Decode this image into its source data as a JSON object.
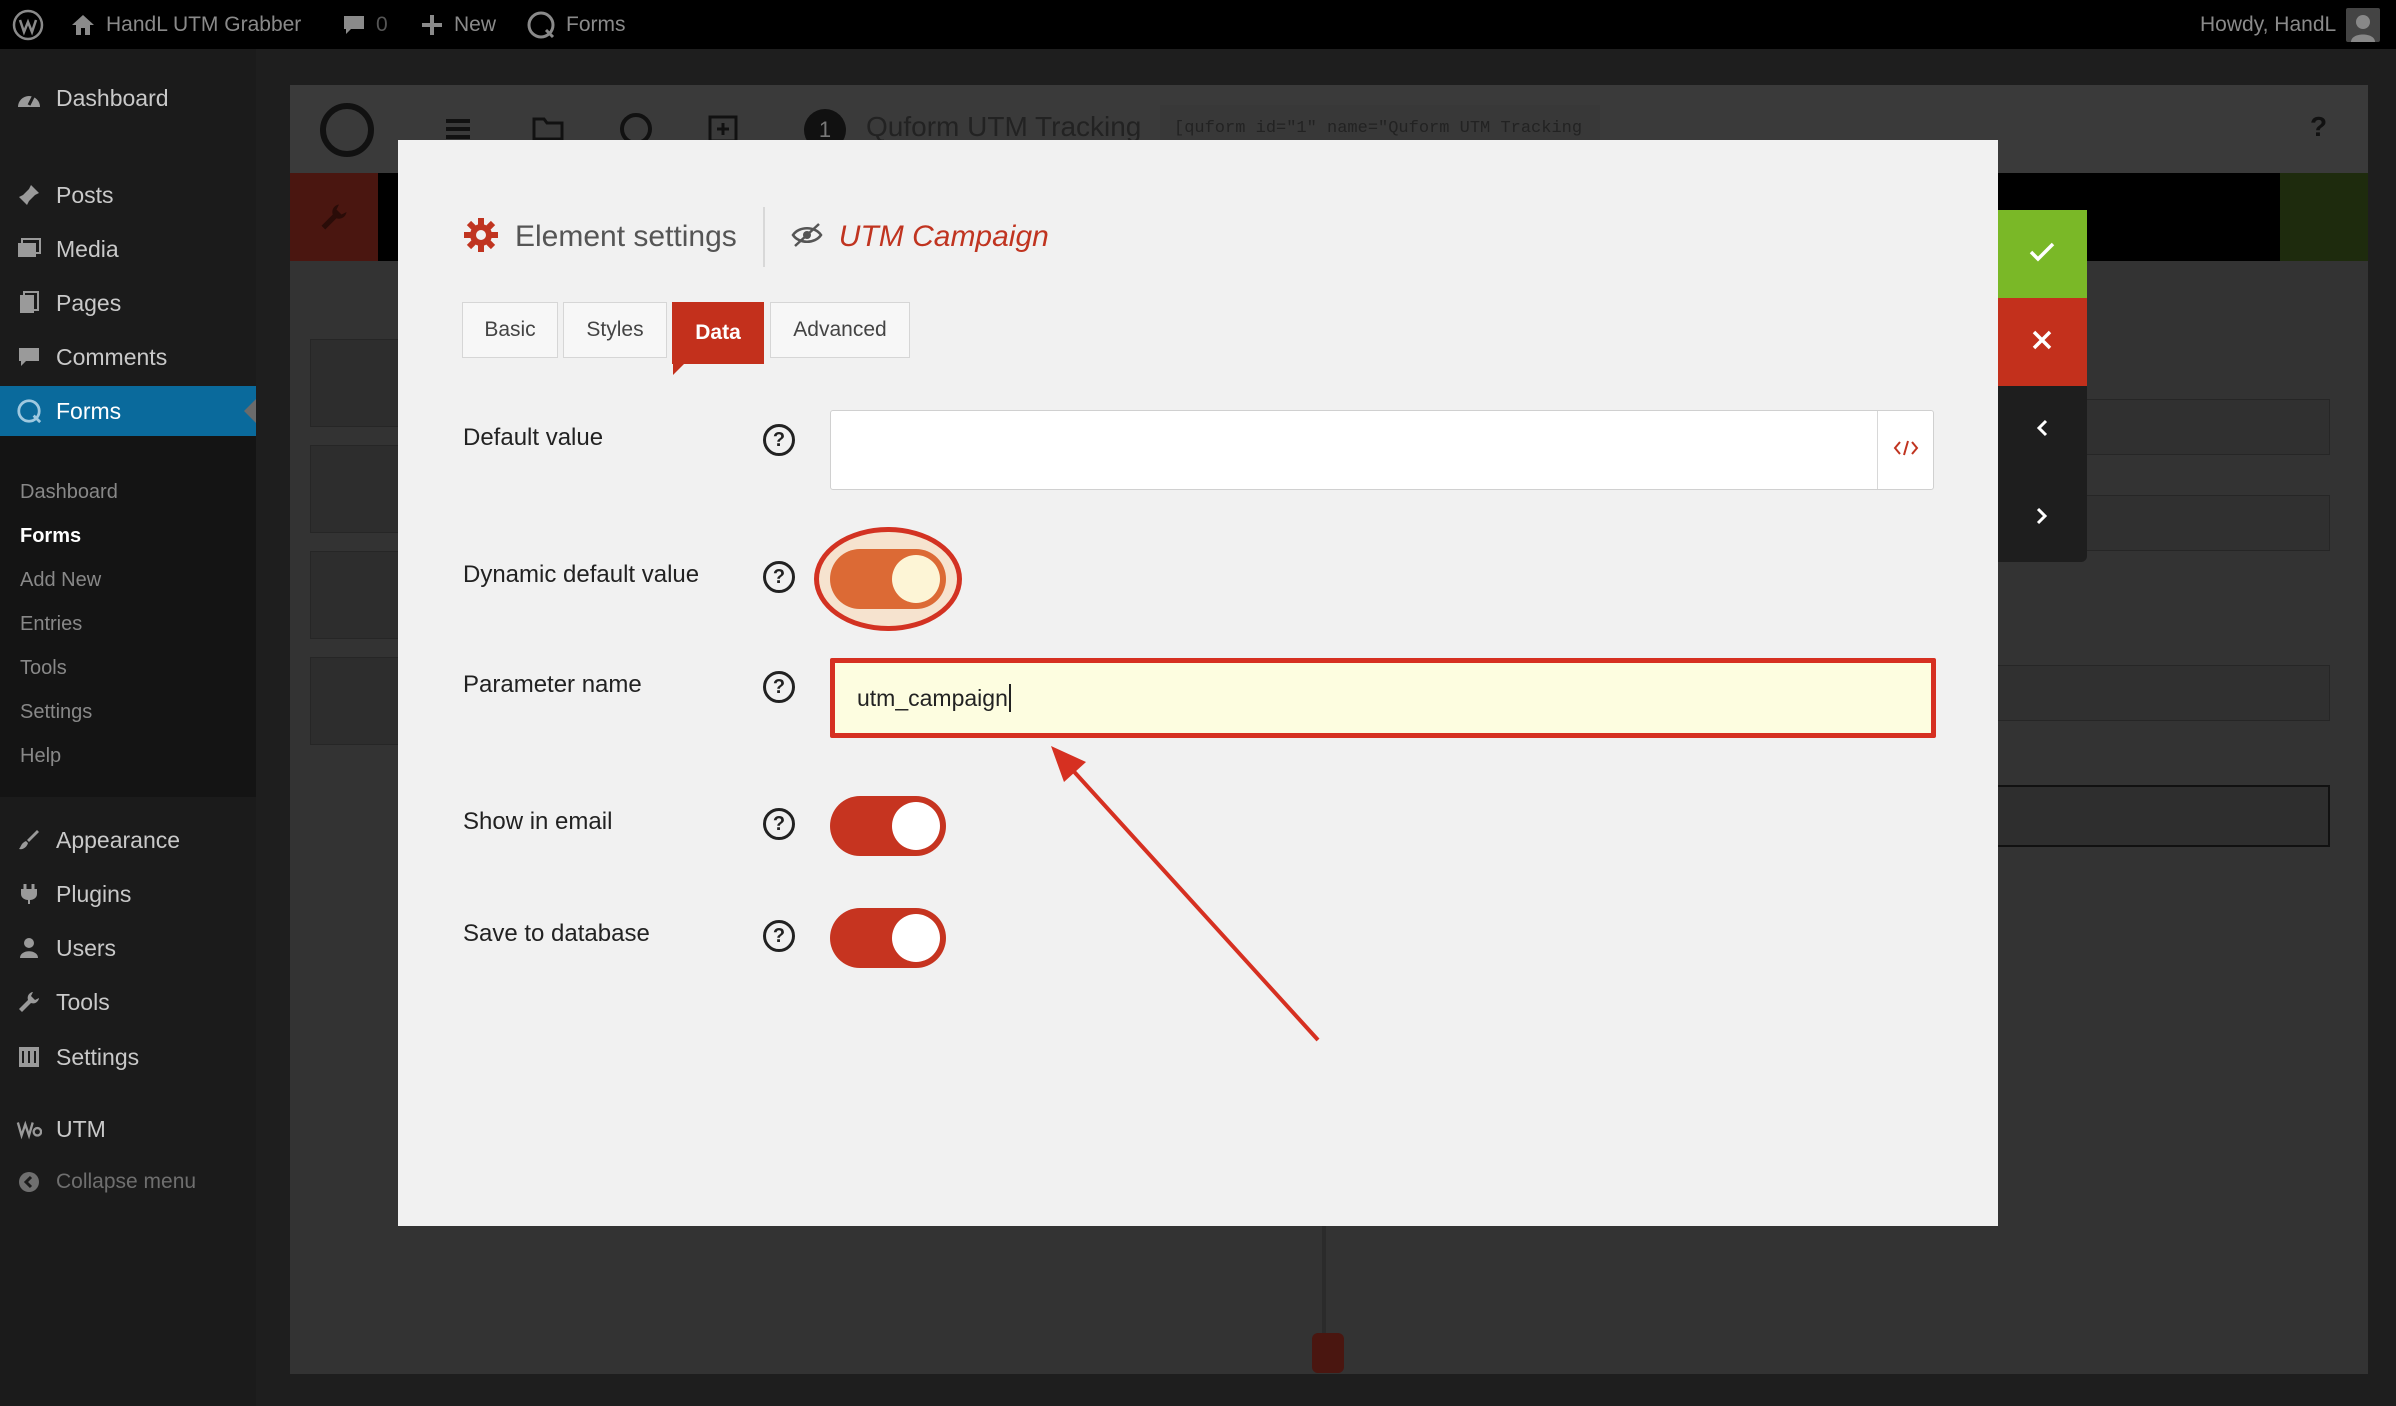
{
  "adminbar": {
    "site_name": "HandL UTM Grabber",
    "comments_count": "0",
    "new_label": "New",
    "forms_label": "Forms",
    "greeting": "Howdy, HandL"
  },
  "sidebar": {
    "items": [
      {
        "label": "Dashboard",
        "icon": "dashboard-icon"
      },
      {
        "label": "Posts",
        "icon": "pin-icon"
      },
      {
        "label": "Media",
        "icon": "media-icon"
      },
      {
        "label": "Pages",
        "icon": "pages-icon"
      },
      {
        "label": "Comments",
        "icon": "comment-icon"
      },
      {
        "label": "Forms",
        "icon": "quform-icon"
      },
      {
        "label": "Appearance",
        "icon": "brush-icon"
      },
      {
        "label": "Plugins",
        "icon": "plug-icon"
      },
      {
        "label": "Users",
        "icon": "user-icon"
      },
      {
        "label": "Tools",
        "icon": "wrench-icon"
      },
      {
        "label": "Settings",
        "icon": "settings-icon"
      },
      {
        "label": "UTM",
        "icon": "utm-icon"
      },
      {
        "label": "Collapse menu",
        "icon": "collapse-icon"
      }
    ],
    "forms_submenu": [
      "Dashboard",
      "Forms",
      "Add New",
      "Entries",
      "Tools",
      "Settings",
      "Help"
    ]
  },
  "builder": {
    "form_number": "1",
    "form_title": "Quform UTM Tracking",
    "shortcode": "[quform id=\"1\" name=\"Quform UTM Tracking",
    "help_label": "?"
  },
  "modal": {
    "title": "Element settings",
    "element_name": "UTM Campaign",
    "tabs": [
      "Basic",
      "Styles",
      "Data",
      "Advanced"
    ],
    "active_tab": "Data",
    "fields": {
      "default_value": {
        "label": "Default value",
        "value": ""
      },
      "dynamic_default_value": {
        "label": "Dynamic default value",
        "on": true
      },
      "parameter_name": {
        "label": "Parameter name",
        "value": "utm_campaign"
      },
      "show_in_email": {
        "label": "Show in email",
        "on": true
      },
      "save_to_database": {
        "label": "Save to database",
        "on": true
      }
    }
  },
  "colors": {
    "accent_red": "#c3301c",
    "confirm_green": "#7ab827",
    "toggle_orange": "#dc6a35",
    "admin_blue": "#0a6a9c"
  }
}
